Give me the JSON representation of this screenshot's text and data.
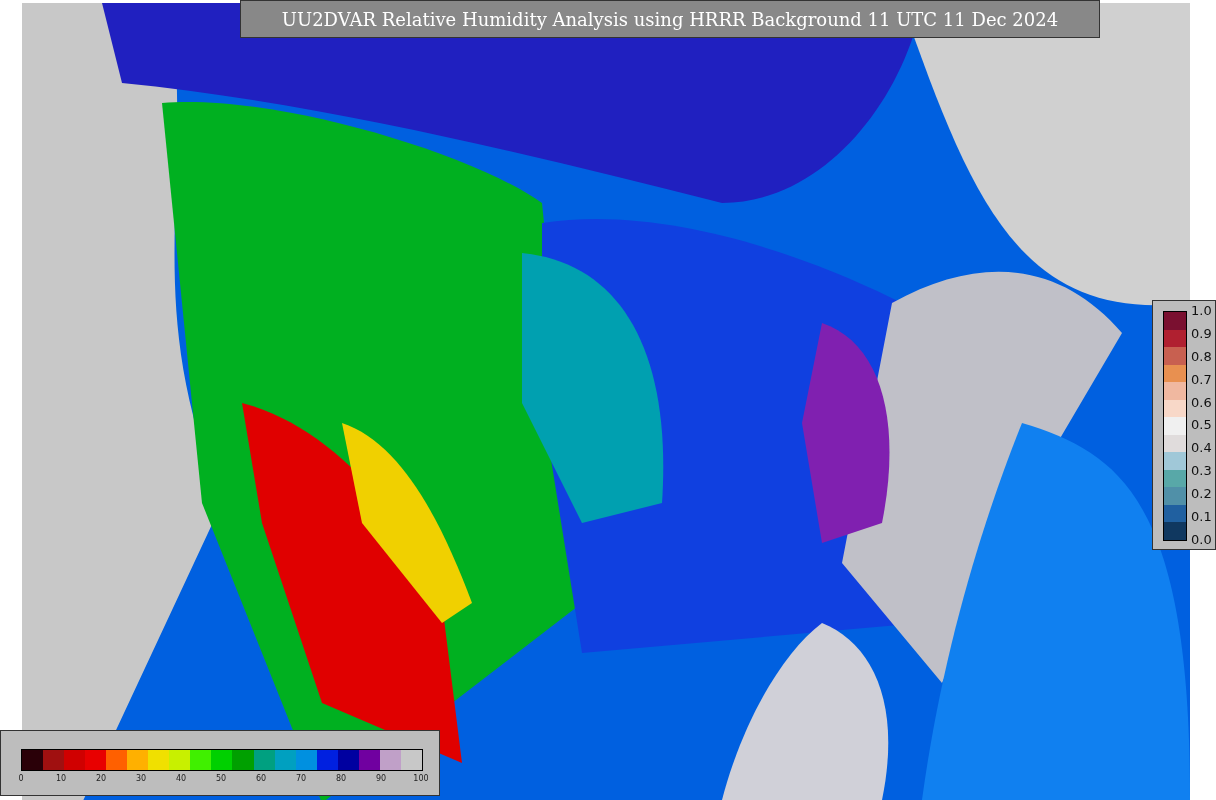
{
  "title": "UU2DVAR Relative Humidity Analysis using HRRR Background 11 UTC 11 Dec 2024",
  "humidity_colorbar": {
    "ticks": [
      "0",
      "10",
      "20",
      "30",
      "40",
      "50",
      "60",
      "70",
      "80",
      "90",
      "100"
    ]
  },
  "observation_colorbar": {
    "ticks": [
      "1.0",
      "0.9",
      "0.8",
      "0.7",
      "0.6",
      "0.5",
      "0.4",
      "0.3",
      "0.2",
      "0.1",
      "0.0"
    ]
  }
}
